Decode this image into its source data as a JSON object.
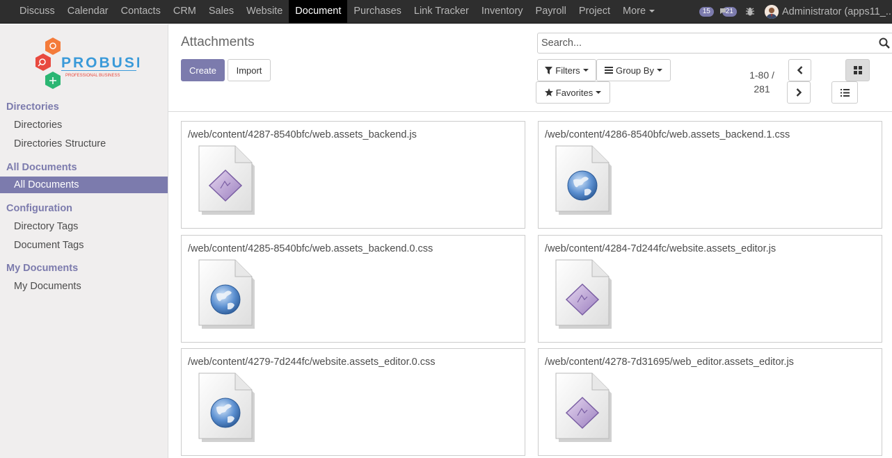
{
  "navbar": {
    "menu": [
      "Discuss",
      "Calendar",
      "Contacts",
      "CRM",
      "Sales",
      "Website",
      "Document",
      "Purchases",
      "Link Tracker",
      "Inventory",
      "Payroll",
      "Project"
    ],
    "active": "Document",
    "more_label": "More",
    "messages_count": "15",
    "activities_count": "21",
    "user_label": "Administrator (apps11_..."
  },
  "logo": {
    "text": "PROBUSE",
    "tagline": "PROFESSIONAL BUSINESS"
  },
  "sidebar": {
    "sections": [
      {
        "heading": "Directories",
        "items": [
          "Directories",
          "Directories Structure"
        ]
      },
      {
        "heading": "All Documents",
        "items": [
          "All Documents"
        ]
      },
      {
        "heading": "Configuration",
        "items": [
          "Directory Tags",
          "Document Tags"
        ]
      },
      {
        "heading": "My Documents",
        "items": [
          "My Documents"
        ]
      }
    ],
    "active_item": "All Documents"
  },
  "control": {
    "title": "Attachments",
    "create_label": "Create",
    "import_label": "Import",
    "search_placeholder": "Search...",
    "filters_label": "Filters",
    "groupby_label": "Group By",
    "favorites_label": "Favorites",
    "pager_range": "1-80 /",
    "pager_total": "281",
    "active_view": "kanban"
  },
  "attachments": [
    {
      "name": "/web/content/4287-8540bfc/web.assets_backend.js",
      "icon": "script-file-icon"
    },
    {
      "name": "/web/content/4286-8540bfc/web.assets_backend.1.css",
      "icon": "web-file-icon"
    },
    {
      "name": "/web/content/4285-8540bfc/web.assets_backend.0.css",
      "icon": "web-file-icon"
    },
    {
      "name": "/web/content/4284-7d244fc/website.assets_editor.js",
      "icon": "script-file-icon"
    },
    {
      "name": "/web/content/4279-7d244fc/website.assets_editor.0.css",
      "icon": "web-file-icon"
    },
    {
      "name": "/web/content/4278-7d31695/web_editor.assets_editor.js",
      "icon": "script-file-icon"
    }
  ],
  "colors": {
    "navbar_bg": "#2e2e2e",
    "accent": "#7c7bad",
    "sidebar_bg": "#f0eeee",
    "logo_orange": "#f47b3a",
    "logo_red": "#e8493f",
    "logo_green": "#2bb673"
  }
}
